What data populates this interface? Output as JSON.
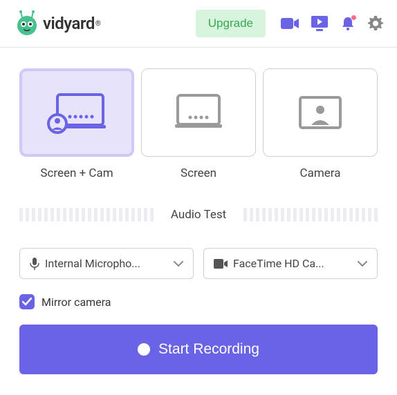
{
  "header": {
    "brand": "vidyard",
    "upgrade": "Upgrade"
  },
  "modes": [
    {
      "label": "Screen + Cam"
    },
    {
      "label": "Screen"
    },
    {
      "label": "Camera"
    }
  ],
  "audio_test_label": "Audio Test",
  "mic_select": "Internal Micropho...",
  "cam_select": "FaceTime HD Ca...",
  "mirror_label": "Mirror camera",
  "start_label": "Start Recording",
  "colors": {
    "primary": "#6b63e6",
    "upgrade_bg": "#d7f5dc",
    "upgrade_text": "#3aa655"
  }
}
